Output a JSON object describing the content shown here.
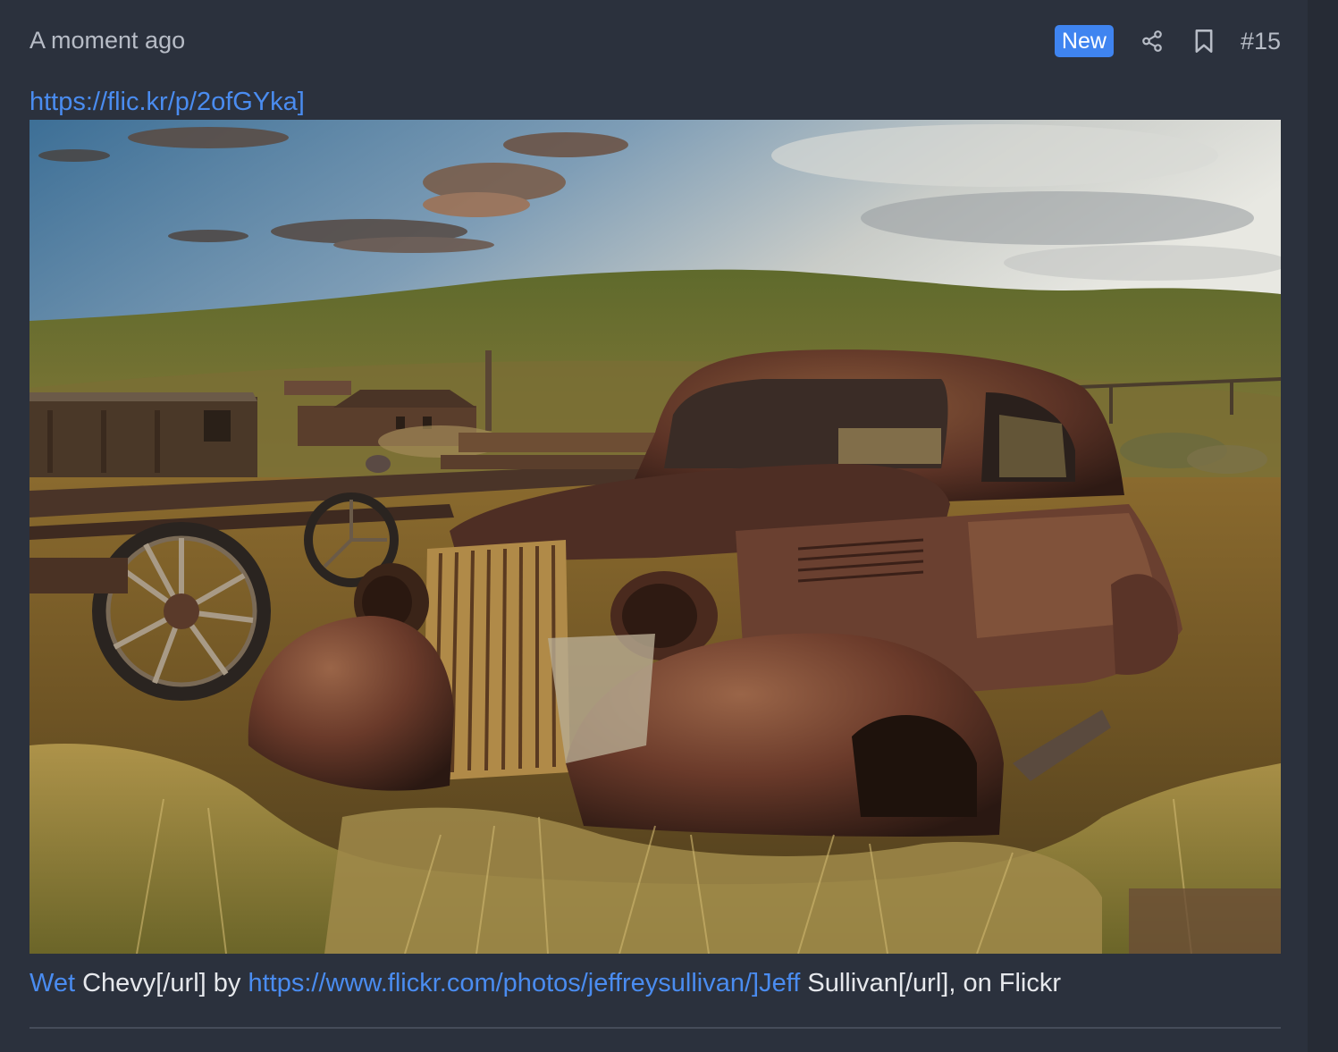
{
  "post": {
    "timestamp": "A moment ago",
    "badge": "New",
    "post_number": "#15",
    "link_text": "https://flic.kr/p/2ofGYka]",
    "image_alt": "Rusted Chevy coupe in tall grass beside an old wagon and weathered wooden buildings on rolling hills",
    "caption": {
      "link1": "Wet",
      "text1": " Chevy[/url] by ",
      "link2": "https://www.flickr.com/photos/jeffreysullivan/]Jeff",
      "text2": " Sullivan[/url], on Flickr"
    }
  },
  "icons": {
    "share": "share-icon",
    "bookmark": "bookmark-icon"
  },
  "colors": {
    "background": "#2b313d",
    "accent": "#3f84f0",
    "link": "#4a8cf0",
    "muted_text": "#b7bcc6",
    "text": "#e6e8ec"
  }
}
